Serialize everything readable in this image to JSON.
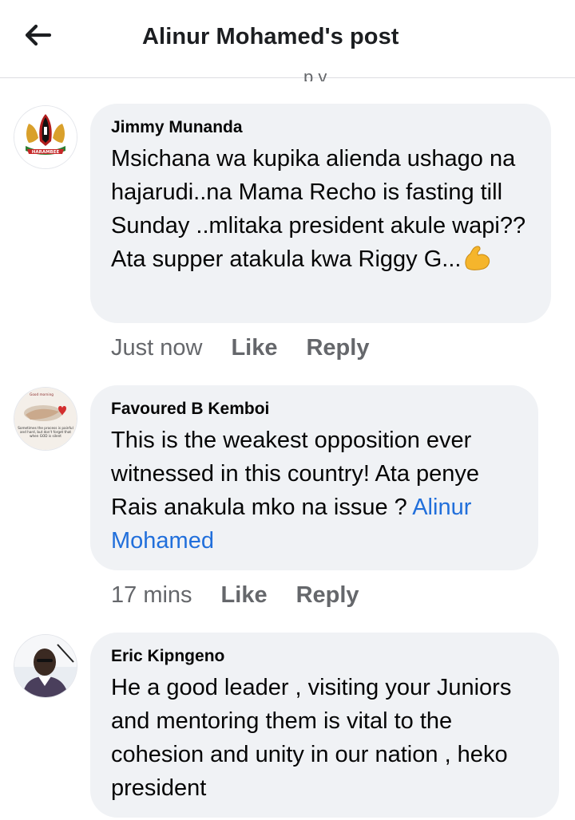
{
  "header": {
    "title": "Alinur Mohamed's post",
    "back_icon": "arrow-left-icon"
  },
  "truncated_text": "p y",
  "colors": {
    "bubble": "#f0f2f5",
    "mention": "#216fdb",
    "secondary": "#65676b"
  },
  "comments": [
    {
      "author": "Jimmy Munanda",
      "text": "Msichana wa kupika alienda ushago na hajarudi..na Mama Recho is fasting till Sunday ..mlitaka president akule wapi?? Ata supper atakula kwa Riggy G...",
      "emoji": "flexed-biceps-emoji",
      "avatar_text": "HARAMBEE",
      "time": "Just now",
      "like": "Like",
      "reply": "Reply"
    },
    {
      "author": "Favoured B Kemboi",
      "text": "This is the weakest opposition ever witnessed in this country! Ata penye Rais anakula mko na issue ? ",
      "mention": "Alinur Mohamed",
      "avatar_text_top": "Good morning",
      "avatar_text_bottom": "Sometimes the process is painful and hard, but don't forget that when GOD is silent",
      "time": "17 mins",
      "like": "Like",
      "reply": "Reply"
    },
    {
      "author": "Eric Kipngeno",
      "text": "He a good leader , visiting your Juniors and mentoring them is vital to the cohesion and unity in our nation , heko president"
    }
  ]
}
